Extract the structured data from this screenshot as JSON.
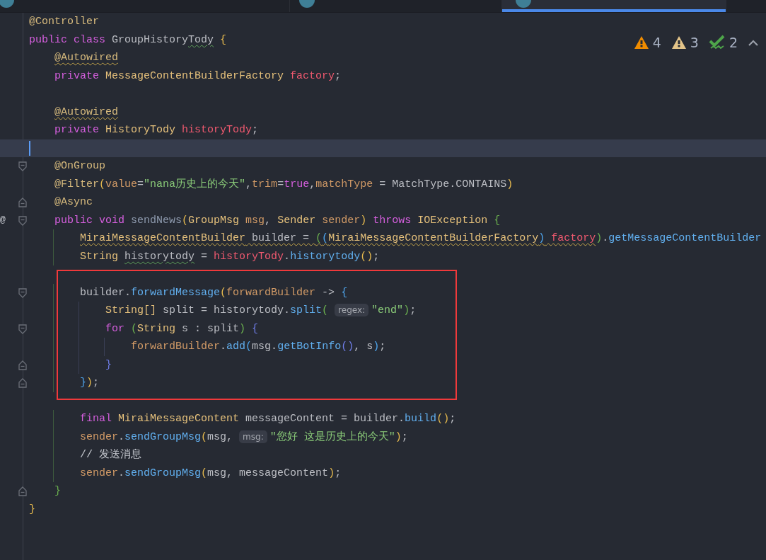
{
  "tabs": [
    {
      "selected": false
    },
    {
      "selected": false
    },
    {
      "selected": true
    }
  ],
  "inspections": [
    {
      "kind": "warning",
      "count": "4"
    },
    {
      "kind": "weak_warning",
      "count": "3"
    },
    {
      "kind": "typo",
      "count": "2"
    }
  ],
  "lines": [
    {
      "kind": "line",
      "current": false,
      "tokens": [
        {
          "kind": "annotation",
          "text": "@Controller"
        }
      ]
    },
    {
      "kind": "line",
      "current": false,
      "tokens": [
        {
          "kind": "keyword",
          "text": "public class "
        },
        {
          "kind": "plain",
          "text": "GroupHistory"
        },
        {
          "kind": "plain",
          "text": "Tody",
          "typo": true
        },
        {
          "kind": "brace_yellow",
          "text": " {"
        }
      ]
    },
    {
      "kind": "line",
      "current": false,
      "tokens": [
        {
          "kind": "annotation",
          "text": "    @Autowired",
          "warning": true
        }
      ]
    },
    {
      "kind": "line",
      "current": false,
      "tokens": [
        {
          "kind": "keyword",
          "text": "    private "
        },
        {
          "kind": "type",
          "text": "MessageContentBuilderFactory"
        },
        {
          "kind": "field",
          "text": " factory"
        },
        {
          "kind": "plain",
          "text": ";"
        }
      ]
    },
    {
      "kind": "line",
      "current": false
    },
    {
      "kind": "line",
      "current": false,
      "tokens": [
        {
          "kind": "annotation",
          "text": "    @Autowired",
          "warning": true
        }
      ]
    },
    {
      "kind": "line",
      "current": false,
      "tokens": [
        {
          "kind": "keyword",
          "text": "    private "
        },
        {
          "kind": "type",
          "text": "HistoryTody"
        },
        {
          "kind": "field",
          "text": " historyTody"
        },
        {
          "kind": "plain",
          "text": ";"
        }
      ]
    },
    {
      "kind": "line",
      "current": true
    },
    {
      "kind": "line",
      "current": false,
      "fold_start": true,
      "tokens": [
        {
          "kind": "annotation",
          "text": "    @OnGroup"
        }
      ]
    },
    {
      "kind": "line",
      "current": false,
      "tokens": [
        {
          "kind": "annotation",
          "text": "    @Filter"
        },
        {
          "kind": "brace_yellow",
          "text": "("
        },
        {
          "kind": "param",
          "text": "value"
        },
        {
          "kind": "plain",
          "text": "="
        },
        {
          "kind": "string",
          "text": "\"nana历史上的今天\""
        },
        {
          "kind": "plain",
          "text": ","
        },
        {
          "kind": "param",
          "text": "trim"
        },
        {
          "kind": "plain",
          "text": "="
        },
        {
          "kind": "keyword",
          "text": "true"
        },
        {
          "kind": "plain",
          "text": ","
        },
        {
          "kind": "param",
          "text": "matchType"
        },
        {
          "kind": "plain",
          "text": " = MatchType.CONTAINS"
        },
        {
          "kind": "brace_yellow",
          "text": ")"
        }
      ]
    },
    {
      "kind": "line",
      "current": false,
      "fold_end": true,
      "tokens": [
        {
          "kind": "annotation",
          "text": "    @Async"
        }
      ]
    },
    {
      "kind": "line",
      "current": false,
      "fold_start": true,
      "marker": "@",
      "tokens": [
        {
          "kind": "keyword",
          "text": "    public void "
        },
        {
          "kind": "decl",
          "text": "sendNews"
        },
        {
          "kind": "brace_yellow",
          "text": "("
        },
        {
          "kind": "type",
          "text": "GroupMsg"
        },
        {
          "kind": "param",
          "text": " msg"
        },
        {
          "kind": "plain",
          "text": ", "
        },
        {
          "kind": "type",
          "text": "Sender"
        },
        {
          "kind": "param",
          "text": " sender"
        },
        {
          "kind": "brace_yellow",
          "text": ")"
        },
        {
          "kind": "keyword",
          "text": " throws "
        },
        {
          "kind": "type",
          "text": "IOException"
        },
        {
          "kind": "brace_green",
          "text": " {"
        }
      ]
    },
    {
      "kind": "line",
      "current": false,
      "tokens": [
        {
          "kind": "type",
          "text": "        MiraiMessageContentBuilder",
          "warning": true
        },
        {
          "kind": "plain",
          "text": " builder = ",
          "warning": true
        },
        {
          "kind": "brace_green",
          "text": "(",
          "warning": true
        },
        {
          "kind": "brace_blue",
          "text": "(",
          "warning": true
        },
        {
          "kind": "type",
          "text": "MiraiMessageContentBuilderFactory",
          "warning": true
        },
        {
          "kind": "brace_blue",
          "text": ")",
          "warning": true
        },
        {
          "kind": "field",
          "text": " factory",
          "warning": true
        },
        {
          "kind": "brace_green",
          "text": ")"
        },
        {
          "kind": "plain",
          "text": "."
        },
        {
          "kind": "method",
          "text": "getMessageContentBuilder"
        }
      ]
    },
    {
      "kind": "line",
      "current": false,
      "tokens": [
        {
          "kind": "type",
          "text": "        String "
        },
        {
          "kind": "plain",
          "text": "historytody",
          "typo": true
        },
        {
          "kind": "plain",
          "text": " = "
        },
        {
          "kind": "field",
          "text": "historyTody"
        },
        {
          "kind": "plain",
          "text": "."
        },
        {
          "kind": "method",
          "text": "historytody"
        },
        {
          "kind": "brace_yellow",
          "text": "()"
        },
        {
          "kind": "plain",
          "text": ";"
        }
      ]
    },
    {
      "kind": "frame",
      "lines": [
        {
          "kind": "line",
          "current": false
        },
        {
          "kind": "line",
          "current": false,
          "fold_start": true,
          "tokens": [
            {
              "kind": "plain",
              "text": "        builder."
            },
            {
              "kind": "method",
              "text": "forwardMessage"
            },
            {
              "kind": "brace_yellow",
              "text": "("
            },
            {
              "kind": "param",
              "text": "forwardBuilder"
            },
            {
              "kind": "plain",
              "text": " -> "
            },
            {
              "kind": "brace_blue",
              "text": "{"
            }
          ]
        },
        {
          "kind": "line",
          "current": false,
          "tokens": [
            {
              "kind": "type",
              "text": "            String[]"
            },
            {
              "kind": "plain",
              "text": " split = historytody."
            },
            {
              "kind": "method",
              "text": "split"
            },
            {
              "kind": "brace_green",
              "text": "( "
            },
            {
              "kind": "hint",
              "text": "regex:"
            },
            {
              "kind": "string",
              "text": "\"end\""
            },
            {
              "kind": "brace_green",
              "text": ")"
            },
            {
              "kind": "plain",
              "text": ";"
            }
          ]
        },
        {
          "kind": "line",
          "current": false,
          "fold_start": true,
          "tokens": [
            {
              "kind": "keyword",
              "text": "            for "
            },
            {
              "kind": "brace_green",
              "text": "("
            },
            {
              "kind": "type",
              "text": "String"
            },
            {
              "kind": "plain",
              "text": " s : split"
            },
            {
              "kind": "brace_green",
              "text": ")"
            },
            {
              "kind": "brace_purple",
              "text": " {"
            }
          ]
        },
        {
          "kind": "line",
          "current": false,
          "tokens": [
            {
              "kind": "param",
              "text": "                forwardBuilder"
            },
            {
              "kind": "plain",
              "text": "."
            },
            {
              "kind": "method",
              "text": "add"
            },
            {
              "kind": "brace_blue",
              "text": "("
            },
            {
              "kind": "plain",
              "text": "msg."
            },
            {
              "kind": "method",
              "text": "getBotInfo"
            },
            {
              "kind": "brace_purple",
              "text": "()"
            },
            {
              "kind": "plain",
              "text": ", s"
            },
            {
              "kind": "brace_blue",
              "text": ")"
            },
            {
              "kind": "plain",
              "text": ";"
            }
          ]
        },
        {
          "kind": "line",
          "current": false,
          "fold_end": true,
          "tokens": [
            {
              "kind": "brace_purple",
              "text": "            }"
            }
          ]
        },
        {
          "kind": "line",
          "current": false,
          "fold_end": true,
          "tokens": [
            {
              "kind": "brace_blue",
              "text": "        }"
            },
            {
              "kind": "brace_yellow",
              "text": ")"
            },
            {
              "kind": "plain",
              "text": ";"
            }
          ]
        },
        {
          "kind": "line",
          "current": false
        }
      ]
    },
    {
      "kind": "line",
      "current": false,
      "tokens": [
        {
          "kind": "keyword",
          "text": "        final "
        },
        {
          "kind": "type",
          "text": "MiraiMessageContent"
        },
        {
          "kind": "plain",
          "text": " messageContent = builder."
        },
        {
          "kind": "method",
          "text": "build"
        },
        {
          "kind": "brace_yellow",
          "text": "()"
        },
        {
          "kind": "plain",
          "text": ";"
        }
      ]
    },
    {
      "kind": "line",
      "current": false,
      "tokens": [
        {
          "kind": "param",
          "text": "        sender"
        },
        {
          "kind": "plain",
          "text": "."
        },
        {
          "kind": "method",
          "text": "sendGroupMsg"
        },
        {
          "kind": "brace_yellow",
          "text": "("
        },
        {
          "kind": "plain",
          "text": "msg, "
        },
        {
          "kind": "hint",
          "text": "msg:"
        },
        {
          "kind": "string",
          "text": "\"您好 这是历史上的今天\""
        },
        {
          "kind": "brace_yellow",
          "text": ")"
        },
        {
          "kind": "plain",
          "text": ";"
        }
      ]
    },
    {
      "kind": "line",
      "current": false,
      "tokens": [
        {
          "kind": "comment",
          "text": "        // 发送消息"
        }
      ]
    },
    {
      "kind": "line",
      "current": false,
      "tokens": [
        {
          "kind": "param",
          "text": "        sender"
        },
        {
          "kind": "plain",
          "text": "."
        },
        {
          "kind": "method",
          "text": "sendGroupMsg"
        },
        {
          "kind": "brace_yellow",
          "text": "("
        },
        {
          "kind": "plain",
          "text": "msg, messageContent"
        },
        {
          "kind": "brace_yellow",
          "text": ")"
        },
        {
          "kind": "plain",
          "text": ";"
        }
      ]
    },
    {
      "kind": "line",
      "current": false,
      "fold_end": true,
      "tokens": [
        {
          "kind": "brace_green",
          "text": "    }"
        }
      ]
    },
    {
      "kind": "line",
      "current": false,
      "tokens": [
        {
          "kind": "brace_yellow",
          "text": "}"
        }
      ]
    }
  ]
}
